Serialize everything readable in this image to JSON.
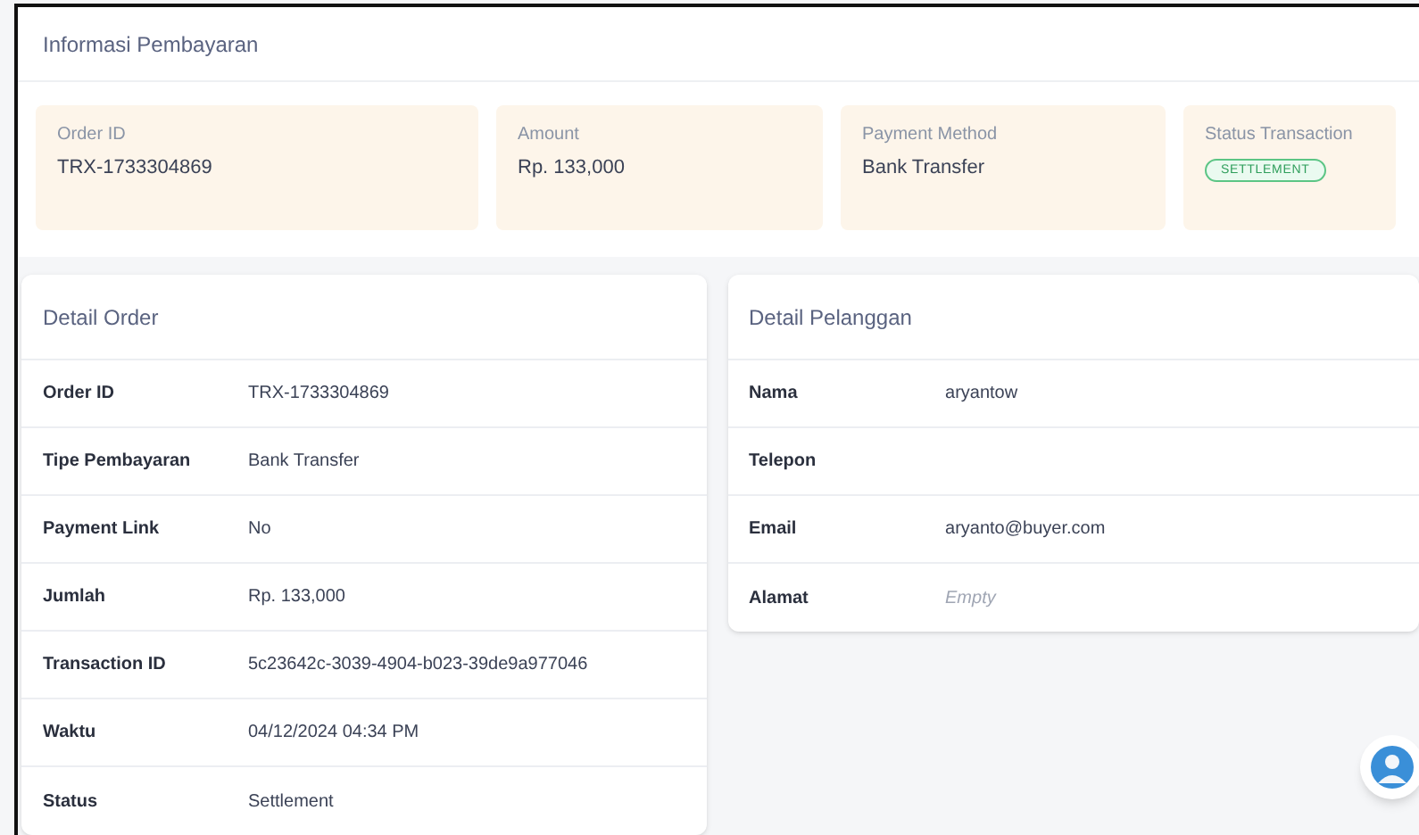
{
  "payment_info": {
    "title": "Informasi Pembayaran",
    "items": [
      {
        "kind": "text",
        "label": "Order ID",
        "value": "TRX-1733304869"
      },
      {
        "kind": "text",
        "label": "Amount",
        "value": "Rp. 133,000"
      },
      {
        "kind": "text",
        "label": "Payment Method",
        "value": "Bank Transfer"
      },
      {
        "kind": "badge",
        "label": "Status Transaction",
        "value": "SETTLEMENT"
      }
    ]
  },
  "detail_order": {
    "title": "Detail Order",
    "rows": [
      {
        "label": "Order ID",
        "value": "TRX-1733304869",
        "empty": false
      },
      {
        "label": "Tipe Pembayaran",
        "value": "Bank Transfer",
        "empty": false
      },
      {
        "label": "Payment Link",
        "value": "No",
        "empty": false
      },
      {
        "label": "Jumlah",
        "value": "Rp. 133,000",
        "empty": false
      },
      {
        "label": "Transaction ID",
        "value": "5c23642c-3039-4904-b023-39de9a977046",
        "empty": false
      },
      {
        "label": "Waktu",
        "value": "04/12/2024 04:34 PM",
        "empty": false
      },
      {
        "label": "Status",
        "value": "Settlement",
        "empty": false
      }
    ]
  },
  "detail_pelanggan": {
    "title": "Detail Pelanggan",
    "rows": [
      {
        "label": "Nama",
        "value": "aryantow",
        "empty": false
      },
      {
        "label": "Telepon"
      },
      {
        "label": "Email",
        "value": "aryanto@buyer.com",
        "empty": false
      },
      {
        "label": "Alamat",
        "value": "Empty",
        "empty": true
      }
    ]
  }
}
